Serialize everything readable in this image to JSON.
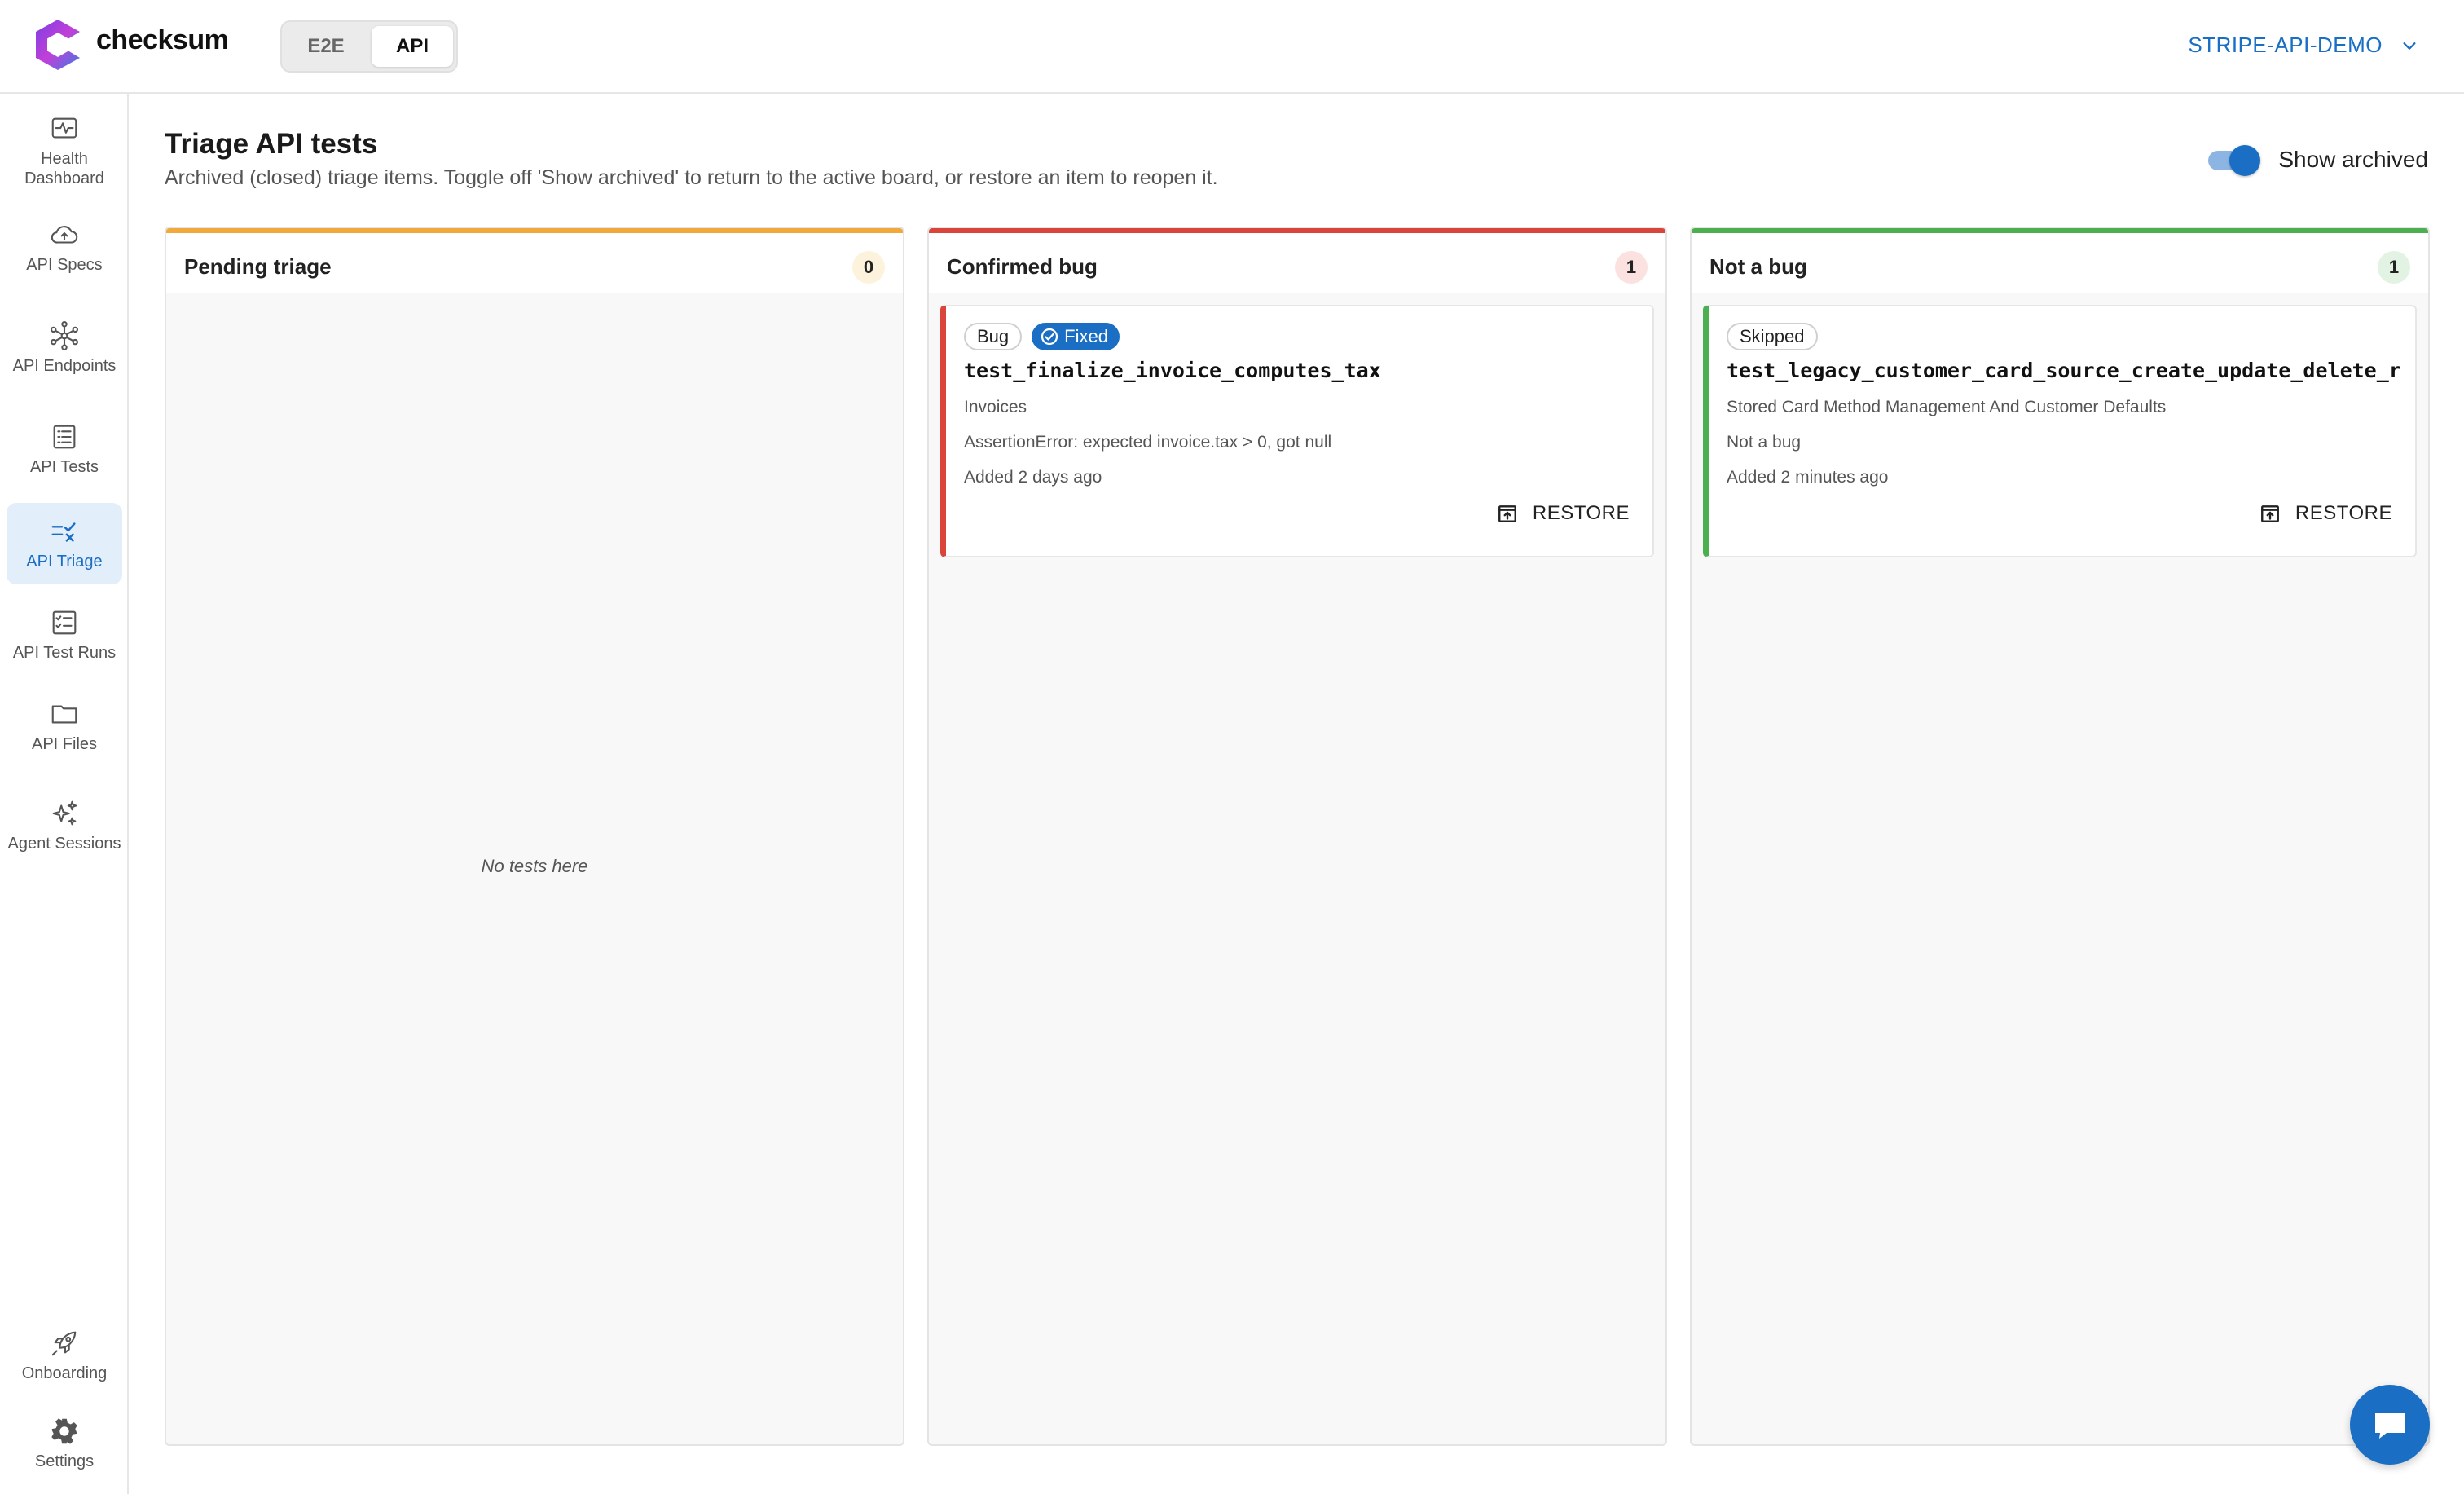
{
  "header": {
    "brand": "checksum",
    "mode_tabs": [
      {
        "label": "E2E"
      },
      {
        "label": "API"
      }
    ],
    "active_mode": "API",
    "project": "STRIPE-API-DEMO"
  },
  "sidebar": {
    "items": [
      {
        "label": "Health Dashboard",
        "icon": "health-icon"
      },
      {
        "label": "API Specs",
        "icon": "cloud-upload-icon"
      },
      {
        "label": "API Endpoints",
        "icon": "network-icon"
      },
      {
        "label": "API Tests",
        "icon": "list-icon"
      },
      {
        "label": "API Triage",
        "icon": "triage-icon",
        "active": true
      },
      {
        "label": "API Test Runs",
        "icon": "checklist-icon"
      },
      {
        "label": "API Files",
        "icon": "folder-icon"
      },
      {
        "label": "Agent Sessions",
        "icon": "sparkles-icon"
      }
    ],
    "bottom": [
      {
        "label": "Onboarding",
        "icon": "rocket-icon"
      },
      {
        "label": "Settings",
        "icon": "gear-icon"
      }
    ]
  },
  "page": {
    "title": "Triage API tests",
    "subtitle": "Archived (closed) triage items. Toggle off 'Show archived' to return to the active board, or restore an item to reopen it.",
    "toggle_label": "Show archived",
    "toggle_on": true
  },
  "columns": [
    {
      "title": "Pending triage",
      "count": "0",
      "accent": "#f0a93a",
      "count_bg": "#fdf3dc",
      "empty_text": "No tests here",
      "cards": []
    },
    {
      "title": "Confirmed bug",
      "count": "1",
      "accent": "#d9453b",
      "count_bg": "#fbe1df",
      "cards": [
        {
          "chips": [
            "Bug",
            "Fixed"
          ],
          "name": "test_finalize_invoice_computes_tax",
          "group": "Invoices",
          "detail": "AssertionError: expected invoice.tax > 0, got null",
          "added": "Added 2 days ago",
          "action": "RESTORE"
        }
      ]
    },
    {
      "title": "Not a bug",
      "count": "1",
      "accent": "#4caf50",
      "count_bg": "#e2f2e3",
      "cards": [
        {
          "chips": [
            "Skipped"
          ],
          "name": "test_legacy_customer_card_source_create_update_delete_r",
          "group": "Stored Card Method Management And Customer Defaults",
          "detail": "Not a bug",
          "added": "Added 2 minutes ago",
          "action": "RESTORE"
        }
      ]
    }
  ],
  "colors": {
    "accent": "#1a6fc4",
    "active_nav_bg": "#e3eefb"
  }
}
